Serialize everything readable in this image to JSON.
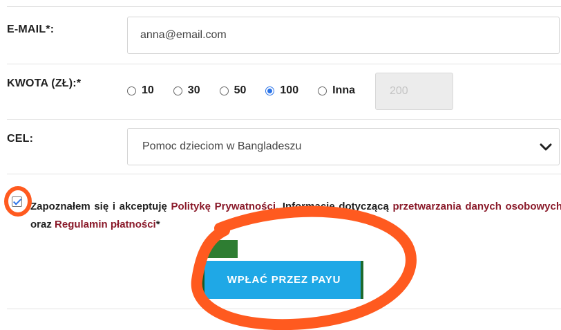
{
  "form": {
    "email": {
      "label": "E-MAIL*:",
      "value": "anna@email.com"
    },
    "amount": {
      "label": "KWOTA (ZŁ):*",
      "options": [
        "10",
        "30",
        "50",
        "100",
        "Inna"
      ],
      "selected": "100",
      "other_value": "200"
    },
    "goal": {
      "label": "CEL:",
      "selected": "Pomoc dzieciom w Bangladeszu"
    },
    "consent": {
      "checked": true,
      "text_1": "Zapoznałem się i akceptuję ",
      "link_privacy": "Politykę Prywatności",
      "text_2": ", Informację dotyczącą ",
      "link_processing": "przetwarzania danych osobowych",
      "text_3": " oraz ",
      "link_terms": "Regulamin płatności",
      "text_4": "*"
    },
    "submit_label": "WPŁAĆ PRZEZ PAYU"
  },
  "colors": {
    "accent": "#1fa8e6",
    "link": "#8a1a2a",
    "annotation": "#ff5a1f"
  }
}
